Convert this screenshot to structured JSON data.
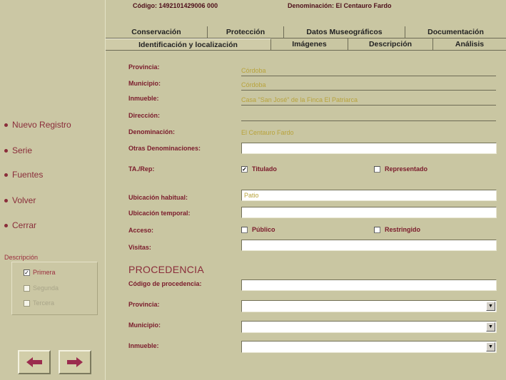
{
  "header": {
    "code": "Código: 1492101429006 000",
    "denomination": "Denominación: El Centauro Fardo"
  },
  "tabs_row1": [
    "Conservación",
    "Protección",
    "Datos Museográficos",
    "Documentación"
  ],
  "tabs_row2": [
    "Identificación y localización",
    "Imágenes",
    "Descripción",
    "Análisis"
  ],
  "active_tab": "Identificación y localización",
  "nav": [
    "Nuevo Registro",
    "Serie",
    "Fuentes",
    "Volver",
    "Cerrar"
  ],
  "description_group": {
    "label": "Descripción",
    "options": [
      {
        "label": "Primera",
        "checked": true,
        "enabled": true
      },
      {
        "label": "Segunda",
        "checked": false,
        "enabled": false
      },
      {
        "label": "Tercera",
        "checked": false,
        "enabled": false
      }
    ]
  },
  "arrows": {
    "prev_icon": "arrow-left-icon",
    "next_icon": "arrow-right-icon",
    "color": "#9b2c4e"
  },
  "form": {
    "provincia": {
      "label": "Provincia:",
      "value": "Córdoba"
    },
    "municipio": {
      "label": "Municipio:",
      "value": "Córdoba"
    },
    "inmueble": {
      "label": "Inmueble:",
      "value": "Casa \"San José\" de la Finca El Patriarca"
    },
    "direccion": {
      "label": "Dirección:",
      "value": ""
    },
    "denominacion": {
      "label": "Denominación:",
      "value": "El Centauro Fardo"
    },
    "otras_denominaciones": {
      "label": "Otras Denominaciones:",
      "value": ""
    },
    "ta_rep": {
      "label": "TA./Rep:",
      "titulado_label": "Titulado",
      "titulado": true,
      "representado_label": "Representado",
      "representado": false
    },
    "ubicacion_habitual": {
      "label": "Ubicación habitual:",
      "value": "Patio"
    },
    "ubicacion_temporal": {
      "label": "Ubicación temporal:",
      "value": ""
    },
    "acceso": {
      "label": "Acceso:",
      "publico_label": "Público",
      "publico": false,
      "restringido_label": "Restringido",
      "restringido": false
    },
    "visitas": {
      "label": "Visitas:",
      "value": ""
    },
    "procedencia_title": "PROCEDENCIA",
    "codigo_procedencia": {
      "label": "Código de procedencia:",
      "value": ""
    },
    "prov_procedencia": {
      "label": "Provincia:",
      "value": ""
    },
    "mun_procedencia": {
      "label": "Municipio:",
      "value": ""
    },
    "inm_procedencia": {
      "label": "Inmueble:",
      "value": ""
    }
  }
}
